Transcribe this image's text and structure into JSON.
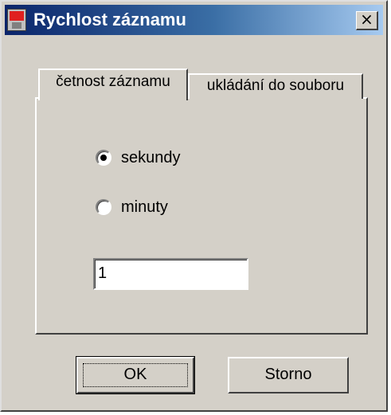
{
  "window": {
    "title": "Rychlost záznamu",
    "close_symbol": "×",
    "icon": "app-icon"
  },
  "tabs": [
    {
      "label": "četnost záznamu",
      "active": true
    },
    {
      "label": "ukládání do souboru",
      "active": false
    }
  ],
  "options": [
    {
      "label": "sekundy",
      "selected": true
    },
    {
      "label": "minuty",
      "selected": false
    }
  ],
  "value_input": {
    "value": "1"
  },
  "buttons": {
    "ok": "OK",
    "cancel": "Storno"
  },
  "colors": {
    "titlebar_start": "#0a246a",
    "titlebar_end": "#a6caf0",
    "face": "#d4d0c8"
  }
}
